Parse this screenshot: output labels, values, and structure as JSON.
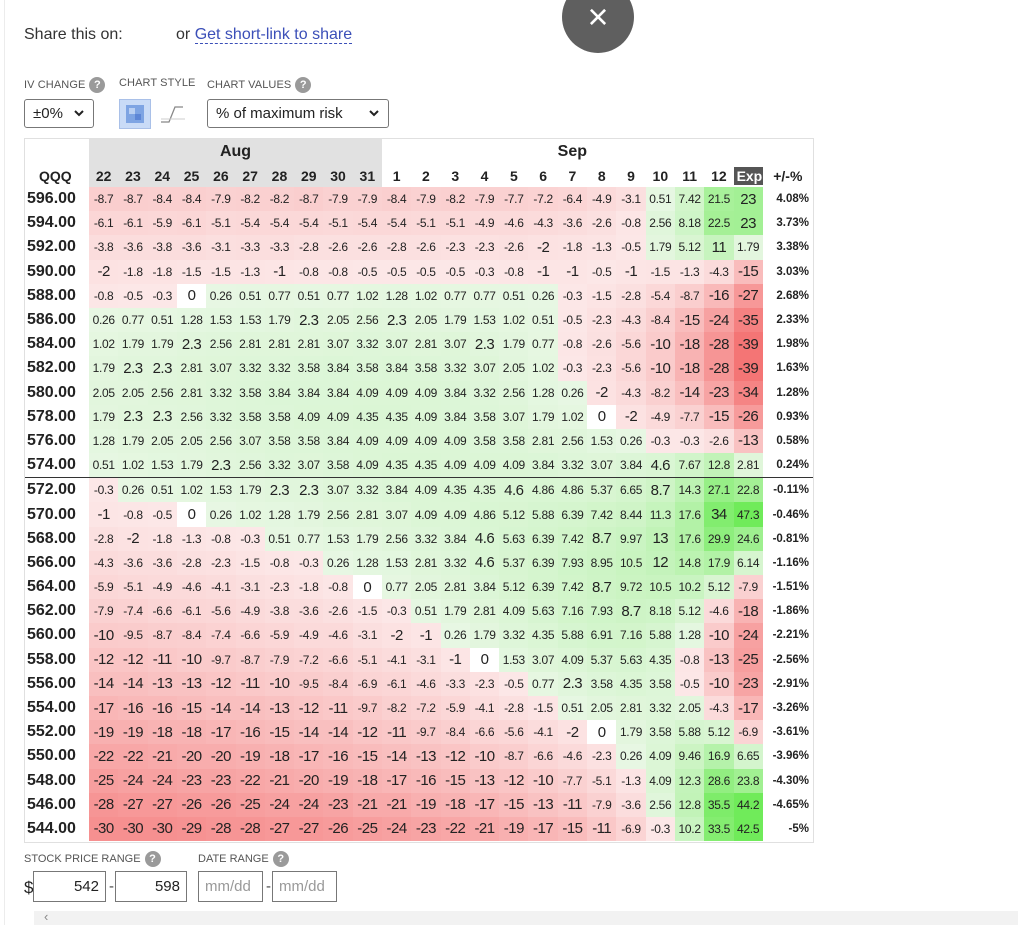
{
  "share": {
    "label": "Share this on:",
    "or": "or",
    "link": "Get short-link to share"
  },
  "close_icon": "×",
  "controls": {
    "iv_label": "IV CHANGE",
    "iv_value": "±0%",
    "chart_style_label": "CHART STYLE",
    "chart_values_label": "CHART VALUES",
    "chart_values_value": "% of maximum risk",
    "help_glyph": "?"
  },
  "table": {
    "ticker": "QQQ",
    "months": [
      "Aug",
      "Sep"
    ],
    "days": [
      "22",
      "23",
      "24",
      "25",
      "26",
      "27",
      "28",
      "29",
      "30",
      "31",
      "1",
      "2",
      "3",
      "4",
      "5",
      "6",
      "7",
      "8",
      "9",
      "10",
      "11",
      "12",
      "Exp"
    ],
    "pct_header": "+/-%",
    "current_after_index": 11,
    "rows": [
      {
        "price": "596.00",
        "vals": [
          "-8.7",
          "-8.7",
          "-8.4",
          "-8.4",
          "-7.9",
          "-8.2",
          "-8.2",
          "-8.7",
          "-7.9",
          "-7.9",
          "-8.4",
          "-7.9",
          "-8.2",
          "-7.9",
          "-7.7",
          "-7.2",
          "-6.4",
          "-4.9",
          "-3.1",
          "0.51",
          "7.42",
          "21.5",
          "23"
        ],
        "pct": "4.08%"
      },
      {
        "price": "594.00",
        "vals": [
          "-6.1",
          "-6.1",
          "-5.9",
          "-6.1",
          "-5.1",
          "-5.4",
          "-5.4",
          "-5.4",
          "-5.1",
          "-5.4",
          "-5.4",
          "-5.1",
          "-5.1",
          "-4.9",
          "-4.6",
          "-4.3",
          "-3.6",
          "-2.6",
          "-0.8",
          "2.56",
          "8.18",
          "22.5",
          "23"
        ],
        "pct": "3.73%"
      },
      {
        "price": "592.00",
        "vals": [
          "-3.8",
          "-3.6",
          "-3.8",
          "-3.6",
          "-3.1",
          "-3.3",
          "-3.3",
          "-2.8",
          "-2.6",
          "-2.6",
          "-2.8",
          "-2.6",
          "-2.3",
          "-2.3",
          "-2.6",
          "-2",
          "-1.8",
          "-1.3",
          "-0.5",
          "1.79",
          "5.12",
          "11",
          "1.79"
        ],
        "pct": "3.38%"
      },
      {
        "price": "590.00",
        "vals": [
          "-2",
          "-1.8",
          "-1.8",
          "-1.5",
          "-1.5",
          "-1.3",
          "-1",
          "-0.8",
          "-0.8",
          "-0.5",
          "-0.5",
          "-0.5",
          "-0.5",
          "-0.3",
          "-0.8",
          "-1",
          "-1",
          "-0.5",
          "-1",
          "-1.5",
          "-1.3",
          "-4.3",
          "-15"
        ],
        "pct": "3.03%"
      },
      {
        "price": "588.00",
        "vals": [
          "-0.8",
          "-0.5",
          "-0.3",
          "0",
          "0.26",
          "0.51",
          "0.77",
          "0.51",
          "0.77",
          "1.02",
          "1.28",
          "1.02",
          "0.77",
          "0.77",
          "0.51",
          "0.26",
          "-0.3",
          "-1.5",
          "-2.8",
          "-5.4",
          "-8.7",
          "-16",
          "-27"
        ],
        "pct": "2.68%"
      },
      {
        "price": "586.00",
        "vals": [
          "0.26",
          "0.77",
          "0.51",
          "1.28",
          "1.53",
          "1.53",
          "1.79",
          "2.3",
          "2.05",
          "2.56",
          "2.3",
          "2.05",
          "1.79",
          "1.53",
          "1.02",
          "0.51",
          "-0.5",
          "-2.3",
          "-4.3",
          "-8.4",
          "-15",
          "-24",
          "-35"
        ],
        "pct": "2.33%"
      },
      {
        "price": "584.00",
        "vals": [
          "1.02",
          "1.79",
          "1.79",
          "2.3",
          "2.56",
          "2.81",
          "2.81",
          "2.81",
          "3.07",
          "3.32",
          "3.07",
          "2.81",
          "3.07",
          "2.3",
          "1.79",
          "0.77",
          "-0.8",
          "-2.6",
          "-5.6",
          "-10",
          "-18",
          "-28",
          "-39"
        ],
        "pct": "1.98%"
      },
      {
        "price": "582.00",
        "vals": [
          "1.79",
          "2.3",
          "2.3",
          "2.81",
          "3.07",
          "3.32",
          "3.32",
          "3.58",
          "3.84",
          "3.58",
          "3.84",
          "3.58",
          "3.32",
          "3.07",
          "2.05",
          "1.02",
          "-0.3",
          "-2.3",
          "-5.6",
          "-10",
          "-18",
          "-28",
          "-39"
        ],
        "pct": "1.63%"
      },
      {
        "price": "580.00",
        "vals": [
          "2.05",
          "2.05",
          "2.56",
          "2.81",
          "3.32",
          "3.58",
          "3.84",
          "3.84",
          "3.84",
          "4.09",
          "4.09",
          "4.09",
          "3.84",
          "3.32",
          "2.56",
          "1.28",
          "0.26",
          "-2",
          "-4.3",
          "-8.2",
          "-14",
          "-23",
          "-34"
        ],
        "pct": "1.28%"
      },
      {
        "price": "578.00",
        "vals": [
          "1.79",
          "2.3",
          "2.3",
          "2.56",
          "3.32",
          "3.58",
          "3.58",
          "4.09",
          "4.09",
          "4.35",
          "4.35",
          "4.09",
          "3.84",
          "3.58",
          "3.07",
          "1.79",
          "1.02",
          "0",
          "-2",
          "-4.9",
          "-7.7",
          "-15",
          "-26"
        ],
        "pct": "0.93%"
      },
      {
        "price": "576.00",
        "vals": [
          "1.28",
          "1.79",
          "2.05",
          "2.05",
          "2.56",
          "3.07",
          "3.58",
          "3.58",
          "3.84",
          "4.09",
          "4.09",
          "4.09",
          "4.09",
          "3.58",
          "3.58",
          "2.81",
          "2.56",
          "1.53",
          "0.26",
          "-0.3",
          "-0.3",
          "-2.6",
          "-13"
        ],
        "pct": "0.58%"
      },
      {
        "price": "574.00",
        "vals": [
          "0.51",
          "1.02",
          "1.53",
          "1.79",
          "2.3",
          "2.56",
          "3.32",
          "3.07",
          "3.58",
          "4.09",
          "4.35",
          "4.35",
          "4.09",
          "4.09",
          "4.09",
          "3.84",
          "3.32",
          "3.07",
          "3.84",
          "4.6",
          "7.67",
          "12.8",
          "2.81"
        ],
        "pct": "0.24%"
      },
      {
        "price": "572.00",
        "vals": [
          "-0.3",
          "0.26",
          "0.51",
          "1.02",
          "1.53",
          "1.79",
          "2.3",
          "2.3",
          "3.07",
          "3.32",
          "3.84",
          "4.09",
          "4.35",
          "4.35",
          "4.6",
          "4.86",
          "4.86",
          "5.37",
          "6.65",
          "8.7",
          "14.3",
          "27.1",
          "22.8"
        ],
        "pct": "-0.11%"
      },
      {
        "price": "570.00",
        "vals": [
          "-1",
          "-0.8",
          "-0.5",
          "0",
          "0.26",
          "1.02",
          "1.28",
          "1.79",
          "2.56",
          "2.81",
          "3.07",
          "4.09",
          "4.09",
          "4.86",
          "5.12",
          "5.88",
          "6.39",
          "7.42",
          "8.44",
          "11.3",
          "17.6",
          "34",
          "47.3"
        ],
        "pct": "-0.46%"
      },
      {
        "price": "568.00",
        "vals": [
          "-2.8",
          "-2",
          "-1.8",
          "-1.3",
          "-0.8",
          "-0.3",
          "0.51",
          "0.77",
          "1.53",
          "1.79",
          "2.56",
          "3.32",
          "3.84",
          "4.6",
          "5.63",
          "6.39",
          "7.42",
          "8.7",
          "9.97",
          "13",
          "17.6",
          "29.9",
          "24.6"
        ],
        "pct": "-0.81%"
      },
      {
        "price": "566.00",
        "vals": [
          "-4.3",
          "-3.6",
          "-3.6",
          "-2.8",
          "-2.3",
          "-1.5",
          "-0.8",
          "-0.3",
          "0.26",
          "1.28",
          "1.53",
          "2.81",
          "3.32",
          "4.6",
          "5.37",
          "6.39",
          "7.93",
          "8.95",
          "10.5",
          "12",
          "14.8",
          "17.9",
          "6.14"
        ],
        "pct": "-1.16%"
      },
      {
        "price": "564.00",
        "vals": [
          "-5.9",
          "-5.1",
          "-4.9",
          "-4.6",
          "-4.1",
          "-3.1",
          "-2.3",
          "-1.8",
          "-0.8",
          "0",
          "0.77",
          "2.05",
          "2.81",
          "3.84",
          "5.12",
          "6.39",
          "7.42",
          "8.7",
          "9.72",
          "10.5",
          "10.2",
          "5.12",
          "-7.9"
        ],
        "pct": "-1.51%"
      },
      {
        "price": "562.00",
        "vals": [
          "-7.9",
          "-7.4",
          "-6.6",
          "-6.1",
          "-5.6",
          "-4.9",
          "-3.8",
          "-3.6",
          "-2.6",
          "-1.5",
          "-0.3",
          "0.51",
          "1.79",
          "2.81",
          "4.09",
          "5.63",
          "7.16",
          "7.93",
          "8.7",
          "8.18",
          "5.12",
          "-4.6",
          "-18"
        ],
        "pct": "-1.86%"
      },
      {
        "price": "560.00",
        "vals": [
          "-10",
          "-9.5",
          "-8.7",
          "-8.4",
          "-7.4",
          "-6.6",
          "-5.9",
          "-4.9",
          "-4.6",
          "-3.1",
          "-2",
          "-1",
          "0.26",
          "1.79",
          "3.32",
          "4.35",
          "5.88",
          "6.91",
          "7.16",
          "5.88",
          "1.28",
          "-10",
          "-24"
        ],
        "pct": "-2.21%"
      },
      {
        "price": "558.00",
        "vals": [
          "-12",
          "-12",
          "-11",
          "-10",
          "-9.7",
          "-8.7",
          "-7.9",
          "-7.2",
          "-6.6",
          "-5.1",
          "-4.1",
          "-3.1",
          "-1",
          "0",
          "1.53",
          "3.07",
          "4.09",
          "5.37",
          "5.63",
          "4.35",
          "-0.8",
          "-13",
          "-25"
        ],
        "pct": "-2.56%"
      },
      {
        "price": "556.00",
        "vals": [
          "-14",
          "-14",
          "-13",
          "-13",
          "-12",
          "-11",
          "-10",
          "-9.5",
          "-8.4",
          "-6.9",
          "-6.1",
          "-4.6",
          "-3.3",
          "-2.3",
          "-0.5",
          "0.77",
          "2.3",
          "3.58",
          "4.35",
          "3.58",
          "-0.5",
          "-10",
          "-23"
        ],
        "pct": "-2.91%"
      },
      {
        "price": "554.00",
        "vals": [
          "-17",
          "-16",
          "-16",
          "-15",
          "-14",
          "-14",
          "-13",
          "-12",
          "-11",
          "-9.7",
          "-8.2",
          "-7.2",
          "-5.9",
          "-4.1",
          "-2.8",
          "-1.5",
          "0.51",
          "2.05",
          "2.81",
          "3.32",
          "2.05",
          "-4.3",
          "-17"
        ],
        "pct": "-3.26%"
      },
      {
        "price": "552.00",
        "vals": [
          "-19",
          "-19",
          "-18",
          "-18",
          "-17",
          "-16",
          "-15",
          "-14",
          "-14",
          "-12",
          "-11",
          "-9.7",
          "-8.4",
          "-6.6",
          "-5.6",
          "-4.1",
          "-2",
          "0",
          "1.79",
          "3.58",
          "5.88",
          "5.12",
          "-6.9"
        ],
        "pct": "-3.61%"
      },
      {
        "price": "550.00",
        "vals": [
          "-22",
          "-22",
          "-21",
          "-20",
          "-20",
          "-19",
          "-18",
          "-17",
          "-16",
          "-15",
          "-14",
          "-13",
          "-12",
          "-10",
          "-8.7",
          "-6.6",
          "-4.6",
          "-2.3",
          "0.26",
          "4.09",
          "9.46",
          "16.9",
          "6.65"
        ],
        "pct": "-3.96%"
      },
      {
        "price": "548.00",
        "vals": [
          "-25",
          "-24",
          "-24",
          "-23",
          "-23",
          "-22",
          "-21",
          "-20",
          "-19",
          "-18",
          "-17",
          "-16",
          "-15",
          "-13",
          "-12",
          "-10",
          "-7.7",
          "-5.1",
          "-1.3",
          "4.09",
          "12.3",
          "28.6",
          "23.8"
        ],
        "pct": "-4.30%"
      },
      {
        "price": "546.00",
        "vals": [
          "-28",
          "-27",
          "-27",
          "-26",
          "-26",
          "-25",
          "-24",
          "-24",
          "-23",
          "-21",
          "-21",
          "-19",
          "-18",
          "-17",
          "-15",
          "-13",
          "-11",
          "-7.9",
          "-3.6",
          "2.56",
          "12.8",
          "35.5",
          "44.2"
        ],
        "pct": "-4.65%"
      },
      {
        "price": "544.00",
        "vals": [
          "-30",
          "-30",
          "-30",
          "-29",
          "-28",
          "-28",
          "-27",
          "-27",
          "-26",
          "-25",
          "-24",
          "-23",
          "-22",
          "-21",
          "-19",
          "-17",
          "-15",
          "-11",
          "-6.9",
          "-0.3",
          "10.2",
          "33.5",
          "42.5"
        ],
        "pct": "-5%"
      }
    ]
  },
  "range": {
    "stock_label": "STOCK PRICE RANGE",
    "date_label": "DATE RANGE",
    "currency": "$",
    "low": "542",
    "high": "598",
    "date_from_placeholder": "mm/dd",
    "date_to_placeholder": "mm/dd",
    "dash": "-"
  },
  "scroll_left_icon": "‹"
}
